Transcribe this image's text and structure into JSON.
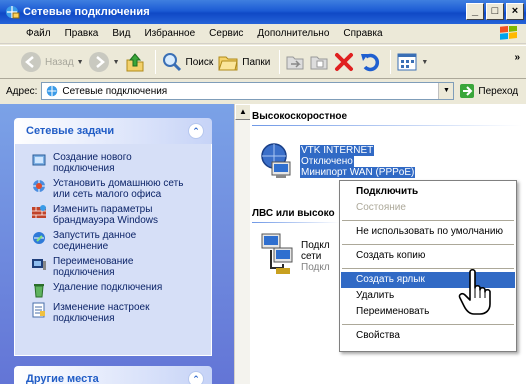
{
  "window": {
    "title": "Сетевые подключения",
    "min": "_",
    "max": "□",
    "close": "×"
  },
  "menu": [
    "Файл",
    "Правка",
    "Вид",
    "Избранное",
    "Сервис",
    "Дополнительно",
    "Справка"
  ],
  "toolbar": {
    "back": "Назад",
    "search": "Поиск",
    "folders": "Папки",
    "more": "»"
  },
  "address": {
    "label": "Адрес:",
    "value": "Сетевые подключения",
    "go": "Переход"
  },
  "tasks_panel": {
    "title": "Сетевые задачи",
    "items": [
      {
        "label_1": "Создание нового",
        "label_2": "подключения",
        "icon": "new-connection-icon"
      },
      {
        "label_1": "Установить домашнюю сеть",
        "label_2": "или сеть малого офиса",
        "icon": "home-network-icon"
      },
      {
        "label_1": "Изменить параметры",
        "label_2": "брандмауэра Windows",
        "icon": "firewall-icon"
      },
      {
        "label_1": "Запустить данное",
        "label_2": "соединение",
        "icon": "connect-icon"
      },
      {
        "label_1": "Переименование",
        "label_2": "подключения",
        "icon": "rename-icon"
      },
      {
        "label_1": "Удаление подключения",
        "label_2": "",
        "icon": "delete-icon"
      },
      {
        "label_1": "Изменение настроек",
        "label_2": "подключения",
        "icon": "settings-icon"
      }
    ]
  },
  "other_panel": {
    "title": "Другие места"
  },
  "content": {
    "group_highspeed": "Высокоскоростное",
    "vtk": {
      "name": "VTK INTERNET",
      "status": "Отключено",
      "device": "Минипорт WAN (PPPoE)"
    },
    "group_lan": "ЛВС или высоко",
    "lan": {
      "line1": "Подкл",
      "line2": "сети",
      "line3": "Подкл"
    }
  },
  "context_menu": {
    "connect": "Подключить",
    "status": "Состояние",
    "not_default": "Не использовать по умолчанию",
    "copy": "Создать копию",
    "shortcut": "Создать ярлык",
    "delete": "Удалить",
    "rename": "Переименовать",
    "properties": "Свойства"
  },
  "colors": {
    "titlebar": "#0f49c6",
    "taskpane": "#6f8ee0",
    "selection": "#316ac5"
  }
}
